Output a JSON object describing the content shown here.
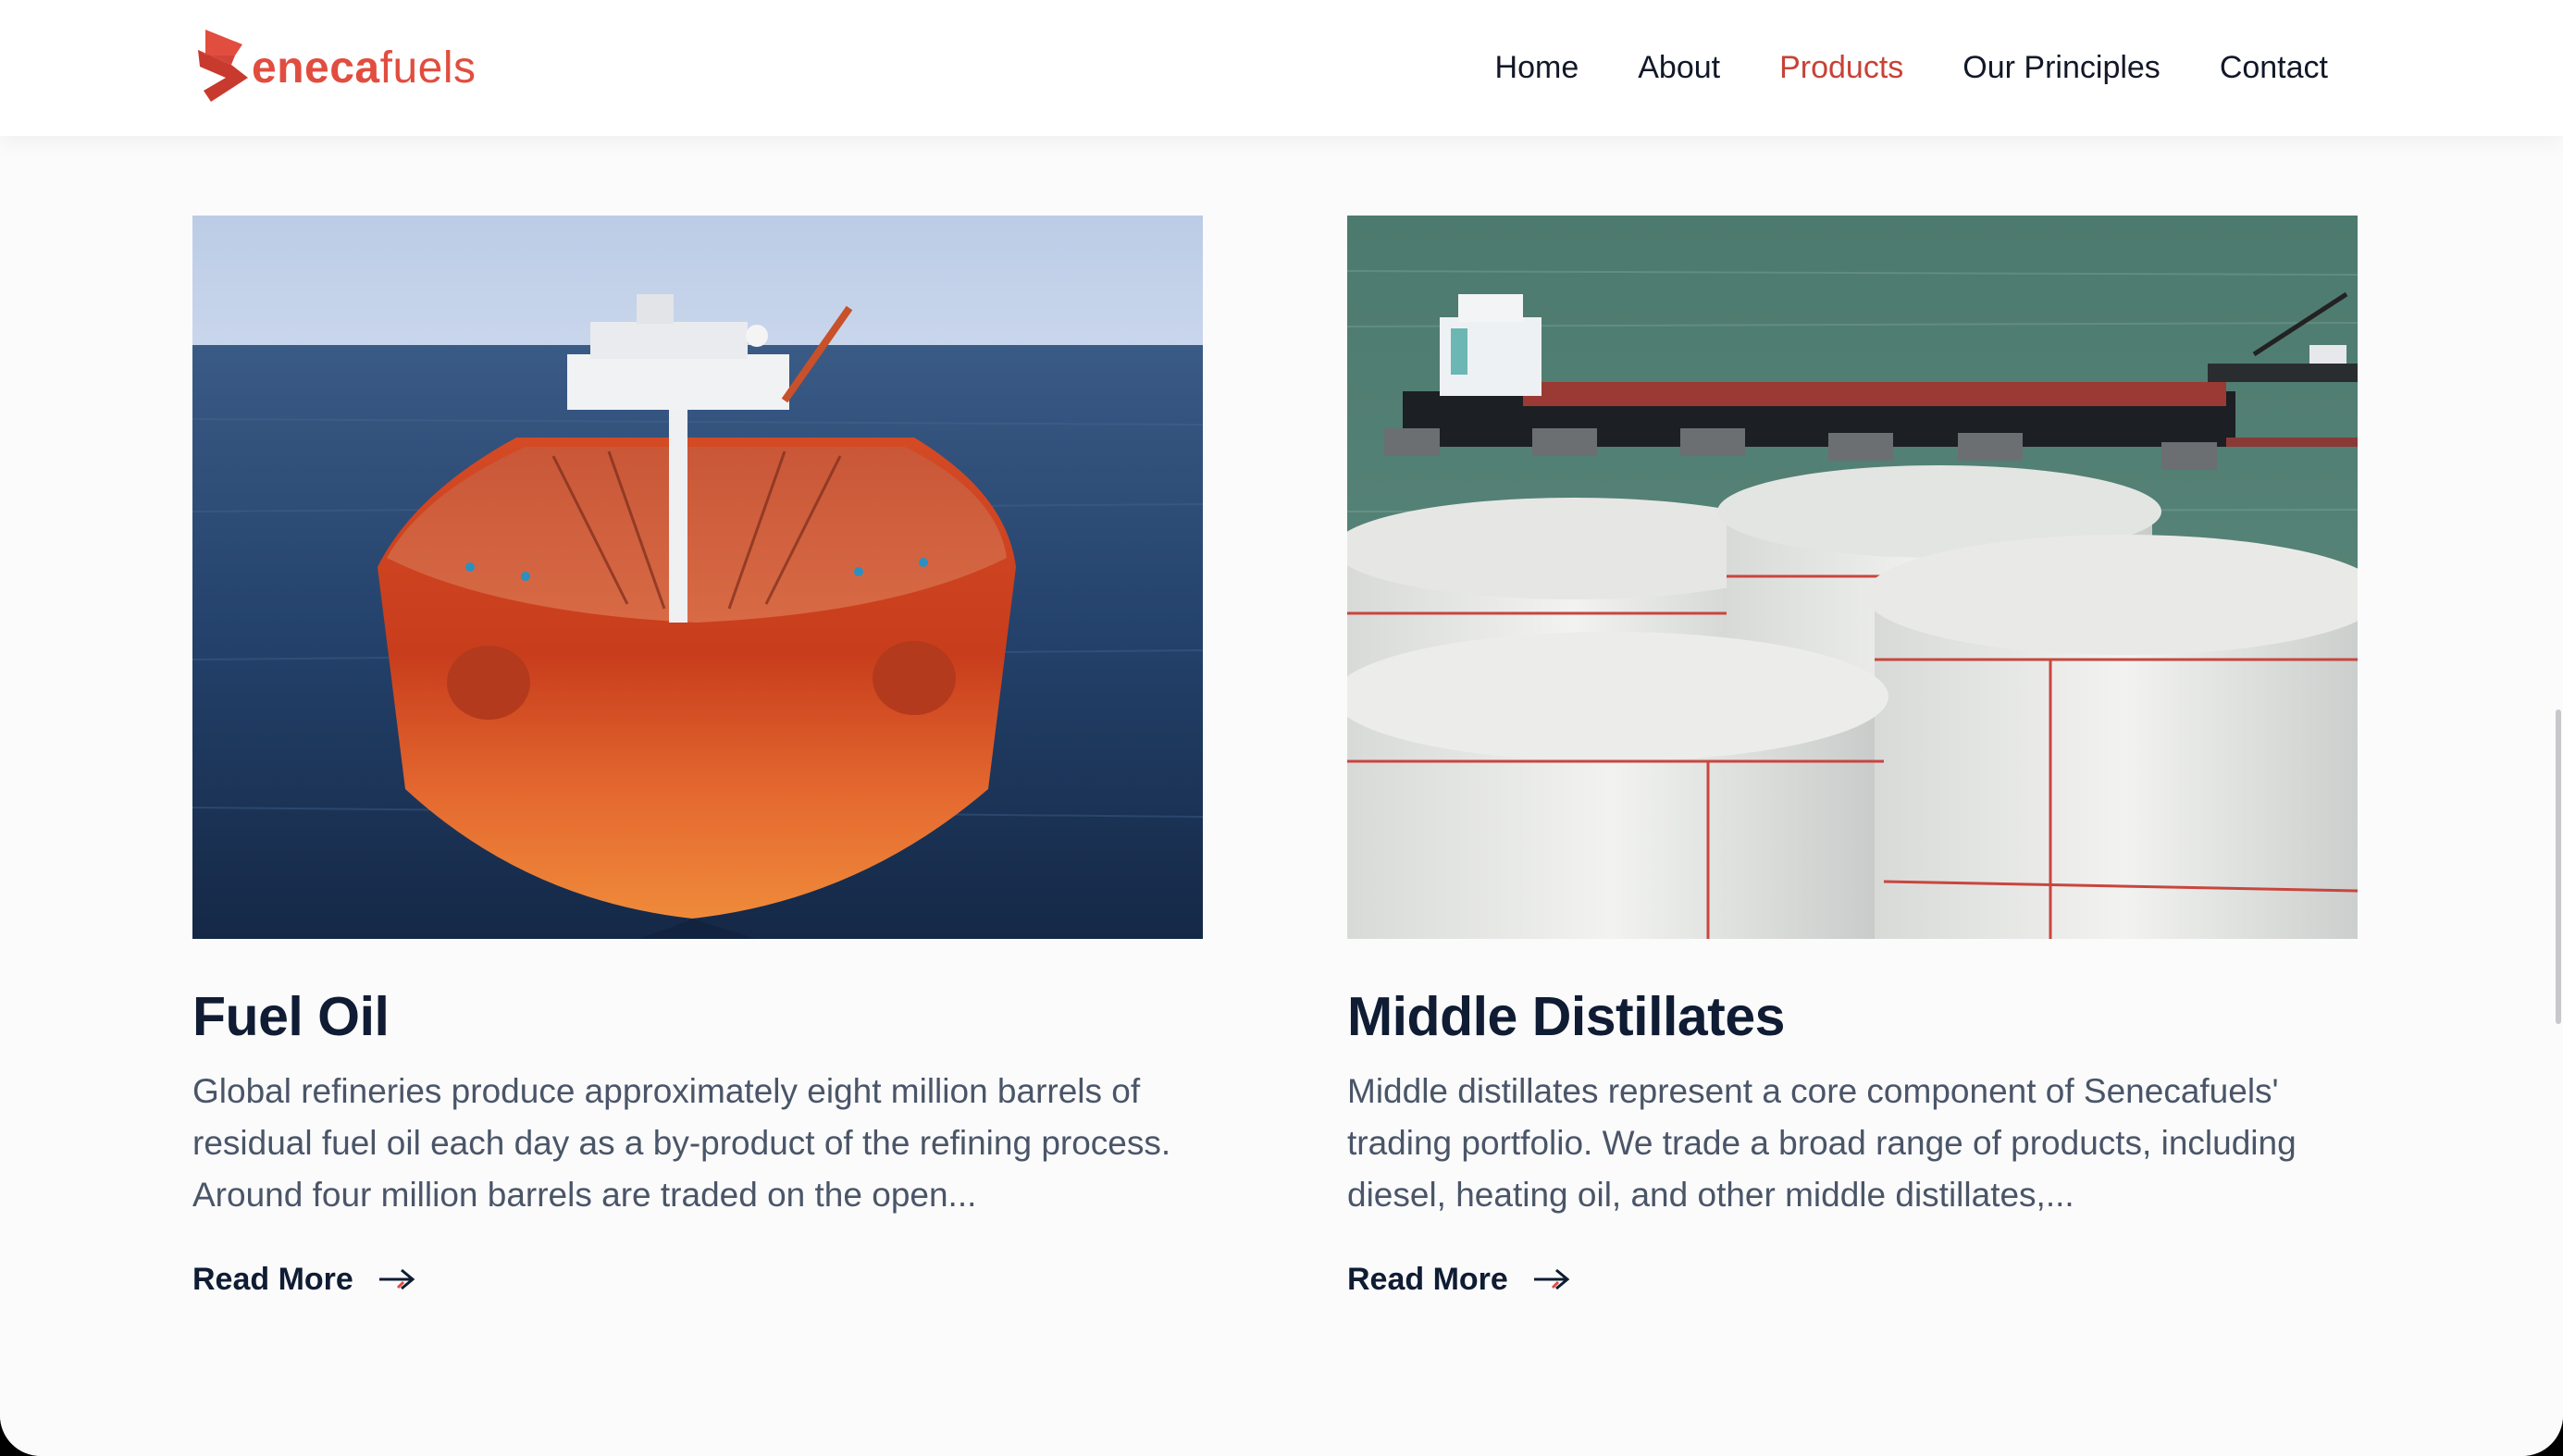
{
  "brand": {
    "name_bold": "eneca",
    "name_light": "fuels",
    "logo_icon": "senecafuels-s-mark",
    "accent_color": "#e14d3f",
    "text_dark": "#0f1c33"
  },
  "nav": {
    "items": [
      {
        "label": "Home",
        "active": false
      },
      {
        "label": "About",
        "active": false
      },
      {
        "label": "Products",
        "active": true
      },
      {
        "label": "Our Principles",
        "active": false
      },
      {
        "label": "Contact",
        "active": false
      }
    ]
  },
  "products": [
    {
      "title": "Fuel Oil",
      "description": "Global refineries produce approximately eight million barrels of residual fuel oil each day as a by-product of the refining process. Around four million barrels are traded on the open...",
      "cta": "Read More",
      "image": "oil-tanker-ship-photo"
    },
    {
      "title": "Middle Distillates",
      "description": "Middle distillates represent a core component of Senecafuels' trading portfolio. We trade a broad range of products, including diesel, heating oil, and other middle distillates,...",
      "cta": "Read More",
      "image": "storage-tanks-and-jetty-photo"
    }
  ]
}
